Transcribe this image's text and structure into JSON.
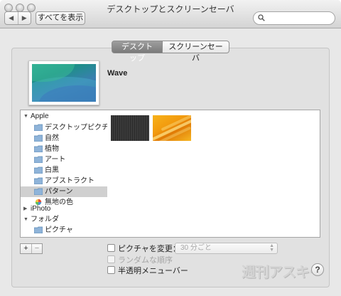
{
  "window": {
    "title": "デスクトップとスクリーンセーバ"
  },
  "toolbar": {
    "back_icon": "chevron-left-icon",
    "forward_icon": "chevron-right-icon",
    "back_glyph": "◀",
    "forward_glyph": "▶",
    "show_all_label": "すべてを表示",
    "search_placeholder": ""
  },
  "tabs": [
    {
      "label": "デスクトップ",
      "selected": true
    },
    {
      "label": "スクリーンセーバ",
      "selected": false
    }
  ],
  "preview": {
    "name": "Wave"
  },
  "source_list": {
    "groups": [
      {
        "label": "Apple",
        "disclosure": "▼",
        "expanded": true
      },
      {
        "label": "iPhoto",
        "disclosure": "▶",
        "expanded": false
      },
      {
        "label": "フォルダ",
        "disclosure": "▼",
        "expanded": true
      }
    ],
    "apple_items": [
      {
        "label": "デスクトップピクチャ",
        "icon": "folder-icon"
      },
      {
        "label": "自然",
        "icon": "folder-icon"
      },
      {
        "label": "植物",
        "icon": "folder-icon"
      },
      {
        "label": "アート",
        "icon": "folder-icon"
      },
      {
        "label": "白黒",
        "icon": "folder-icon"
      },
      {
        "label": "アブストラクト",
        "icon": "folder-icon"
      },
      {
        "label": "パターン",
        "icon": "folder-icon",
        "selected": true
      },
      {
        "label": "無地の色",
        "icon": "color-wheel-icon"
      }
    ],
    "folder_items": [
      {
        "label": "ピクチャ",
        "icon": "folder-icon"
      }
    ]
  },
  "thumbnails": [
    {
      "name": "dark-pattern",
      "color": "#2f2f2f"
    },
    {
      "name": "orange-pattern",
      "color": "#f4a417"
    }
  ],
  "buttons": {
    "add": "+",
    "remove": "−",
    "help": "?"
  },
  "options": {
    "change_picture": {
      "label": "ピクチャを変更：",
      "checked": false
    },
    "interval_select": {
      "value": "30 分ごと",
      "enabled": false
    },
    "random_order": {
      "label": "ランダムな順序",
      "checked": false,
      "enabled": false
    },
    "translucent_menu": {
      "label": "半透明メニューバー",
      "checked": false
    }
  },
  "watermark": "週刊アスキー",
  "colors": {
    "selected_tab": "#8a8a8a",
    "selection": "#d0d0d0",
    "window_bg": "#e8e8e8"
  }
}
